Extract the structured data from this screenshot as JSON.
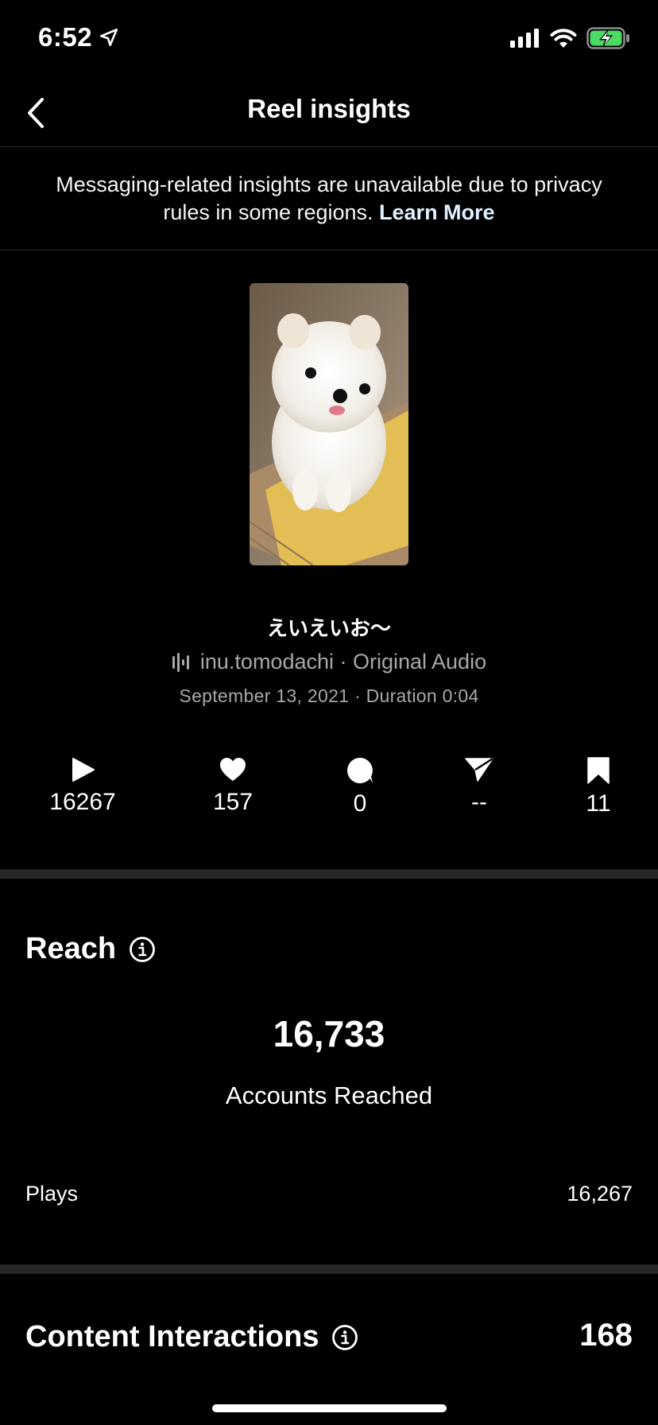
{
  "status_bar": {
    "time": "6:52"
  },
  "header": {
    "title": "Reel insights"
  },
  "notice": {
    "text": "Messaging-related insights are unavailable due to privacy rules in some regions. ",
    "link": "Learn More"
  },
  "reel": {
    "title": "えいえいお〜",
    "audio": "inu.tomodachi · Original Audio",
    "date_duration": "September 13, 2021 · Duration 0:04"
  },
  "stats": {
    "plays": "16267",
    "likes": "157",
    "comments": "0",
    "shares": "--",
    "saves": "11"
  },
  "reach": {
    "title": "Reach",
    "accounts_reached_value": "16,733",
    "accounts_reached_label": "Accounts Reached",
    "plays_label": "Plays",
    "plays_value": "16,267"
  },
  "content_interactions": {
    "title": "Content Interactions",
    "value": "168"
  },
  "colors": {
    "background": "#000000",
    "divider": "#262626",
    "secondary_text": "#a8a8a8",
    "battery": "#4cd964"
  }
}
